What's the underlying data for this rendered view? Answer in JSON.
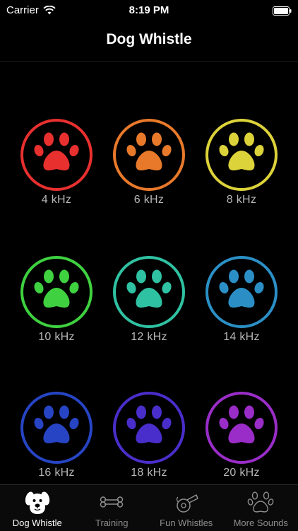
{
  "status_bar": {
    "carrier": "Carrier",
    "time": "8:19 PM",
    "wifi_icon": "wifi-icon",
    "battery_icon": "battery-icon"
  },
  "nav": {
    "title": "Dog Whistle"
  },
  "whistles": [
    {
      "label": "4 kHz",
      "color": "#e8302f"
    },
    {
      "label": "6 kHz",
      "color": "#e8792a"
    },
    {
      "label": "8 kHz",
      "color": "#dcd23a"
    },
    {
      "label": "10 kHz",
      "color": "#3fd13f"
    },
    {
      "label": "12 kHz",
      "color": "#2fc2a2"
    },
    {
      "label": "14 kHz",
      "color": "#2b8fc6"
    },
    {
      "label": "16 kHz",
      "color": "#2644c4"
    },
    {
      "label": "18 kHz",
      "color": "#4a2ecb"
    },
    {
      "label": "20 kHz",
      "color": "#9a2dc8"
    }
  ],
  "tabs": [
    {
      "label": "Dog Whistle",
      "icon": "dog-face-icon",
      "active": true
    },
    {
      "label": "Training",
      "icon": "bone-icon",
      "active": false
    },
    {
      "label": "Fun Whistles",
      "icon": "whistle-icon",
      "active": false
    },
    {
      "label": "More Sounds",
      "icon": "paw-icon",
      "active": false
    }
  ]
}
